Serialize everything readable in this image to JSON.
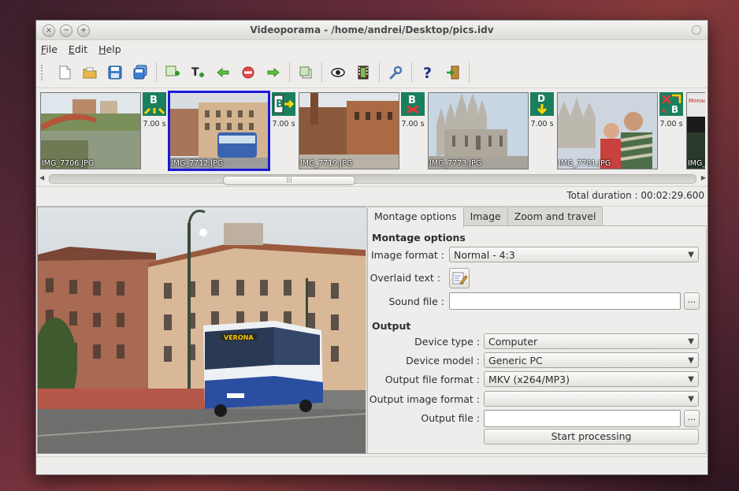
{
  "window": {
    "title": "Videoporama - /home/andrei/Desktop/pics.idv"
  },
  "menu": [
    "File",
    "Edit",
    "Help"
  ],
  "toolbar": [
    "new-document",
    "open-folder",
    "save",
    "save-as",
    "add-image",
    "add-text",
    "move-left",
    "remove",
    "move-right",
    "duplicate",
    "preview-eye",
    "render-film",
    "settings-wrench",
    "help",
    "exit"
  ],
  "slides": [
    {
      "file": "IMG_7706.JPG",
      "duration": "7.00 s",
      "selected": false
    },
    {
      "file": "IMG_7712.JPG",
      "duration": "7.00 s",
      "selected": true
    },
    {
      "file": "IMG_7719.JPG",
      "duration": "7.00 s",
      "selected": false
    },
    {
      "file": "IMG_7773.JPG",
      "duration": "7.00 s",
      "selected": false
    },
    {
      "file": "IMG_7781.JPG",
      "duration": "7.00 s",
      "selected": false
    },
    {
      "file": "IMG_",
      "duration": "",
      "selected": false
    }
  ],
  "total_duration": "Total duration : 00:02:29.600",
  "tabs": [
    "Montage options",
    "Image",
    "Zoom and travel"
  ],
  "montage": {
    "section": "Montage options",
    "image_format_label": "Image format :",
    "image_format_value": "Normal - 4:3",
    "overlaid_text_label": "Overlaid text :",
    "sound_file_label": "Sound file :",
    "browse": "..."
  },
  "output": {
    "section": "Output",
    "device_type_label": "Device type :",
    "device_type_value": "Computer",
    "device_model_label": "Device model :",
    "device_model_value": "Generic PC",
    "file_format_label": "Output file format :",
    "file_format_value": "MKV (x264/MP3)",
    "image_format_label": "Output image format :",
    "image_format_value": "",
    "file_label": "Output file :",
    "browse": "...",
    "start": "Start processing"
  },
  "preview_sign": "VERONA"
}
